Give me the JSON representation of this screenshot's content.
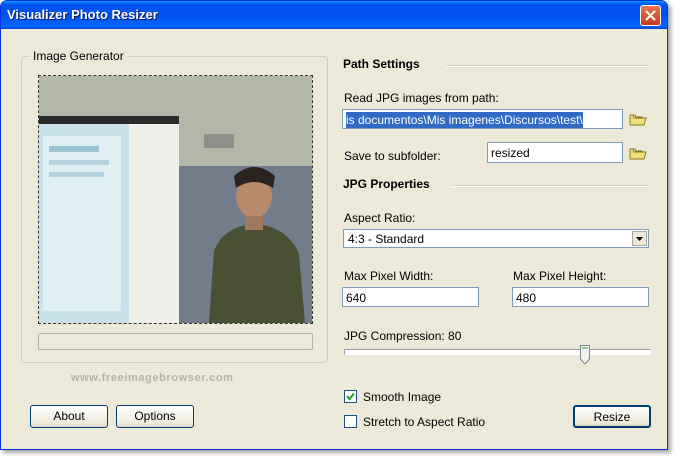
{
  "window": {
    "title": "Visualizer Photo Resizer"
  },
  "image_generator": {
    "group_title": "Image Generator",
    "watermark": "www.freeimagebrowser.com"
  },
  "buttons": {
    "about": "About",
    "options": "Options",
    "resize": "Resize"
  },
  "path_settings": {
    "heading": "Path Settings",
    "read_label": "Read JPG images from path:",
    "read_value": "is documentos\\Mis imagenes\\Discursos\\test\\",
    "subfolder_label": "Save to subfolder:",
    "subfolder_value": "resized"
  },
  "jpg_properties": {
    "heading": "JPG Properties",
    "aspect_label": "Aspect Ratio:",
    "aspect_value": "4:3  - Standard",
    "width_label": "Max Pixel Width:",
    "width_value": "640",
    "height_label": "Max Pixel Height:",
    "height_value": "480",
    "compression_label": "JPG Compression: 80",
    "compression_value": 80
  },
  "options": {
    "smooth_label": "Smooth Image",
    "smooth_checked": true,
    "stretch_label": "Stretch to Aspect Ratio",
    "stretch_checked": false
  },
  "icons": {
    "close": "close-icon",
    "folder": "folder-icon",
    "dropdown": "chevron-down-icon"
  },
  "colors": {
    "titlebar": "#0054e3",
    "selection": "#316ac5",
    "close": "#d4502b",
    "folder": "#e8d36a"
  }
}
